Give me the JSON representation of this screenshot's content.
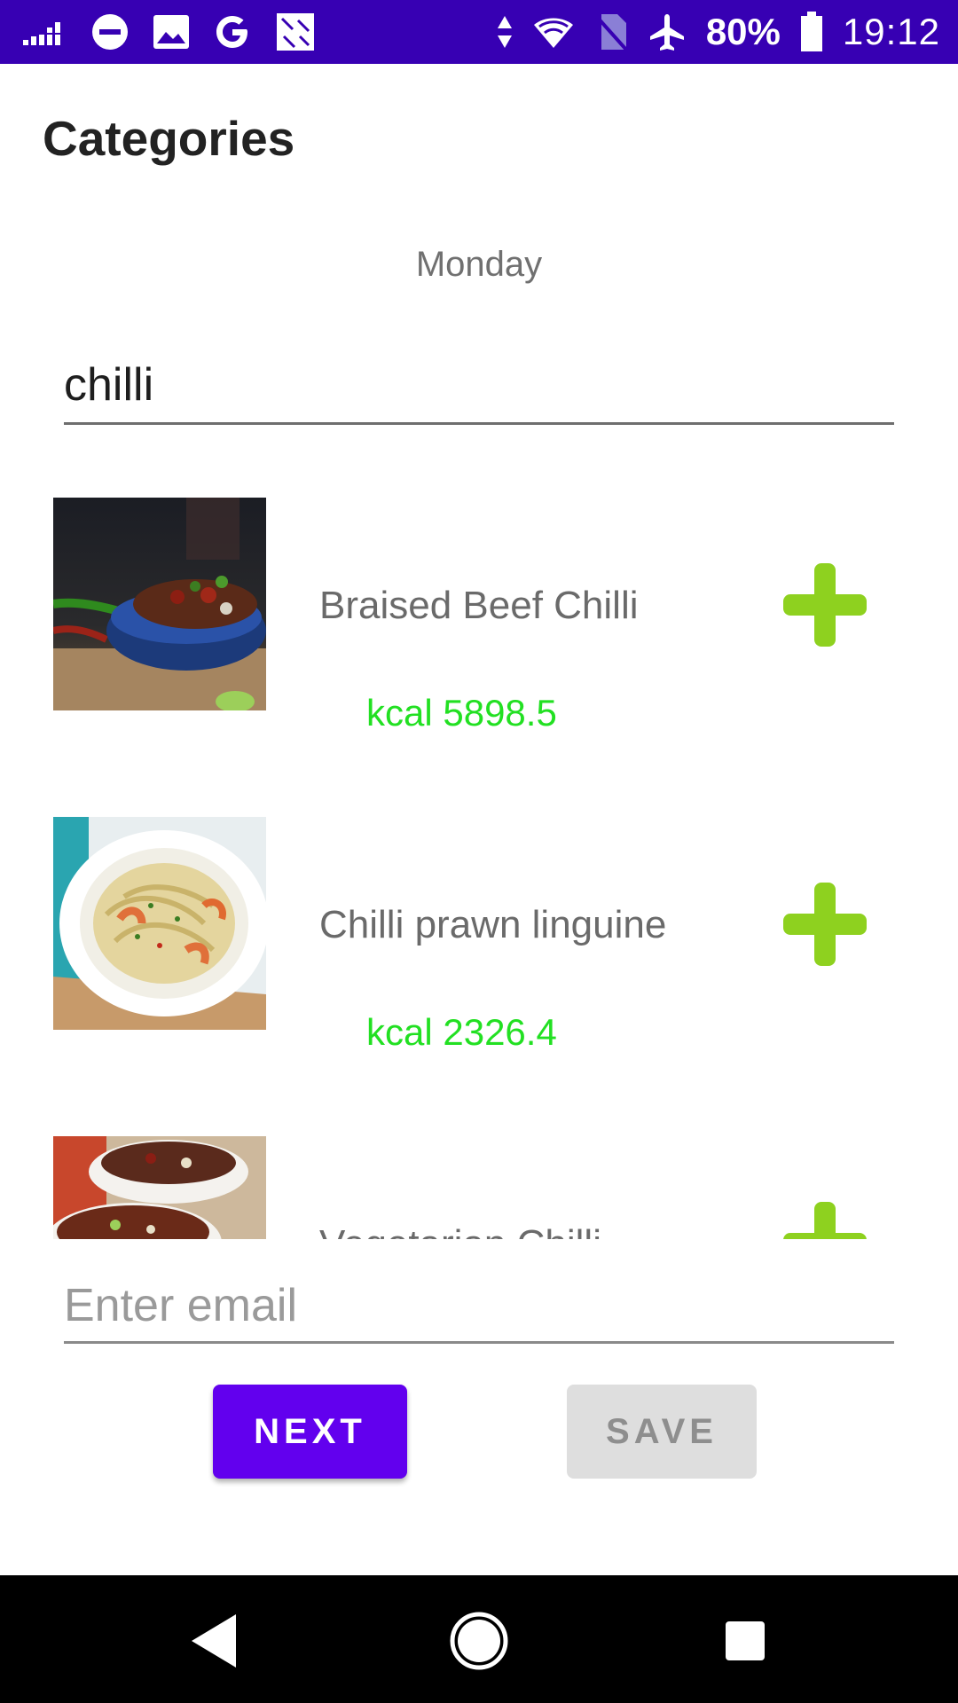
{
  "status_bar": {
    "battery_percent": "80%",
    "time": "19:12",
    "left_icons": [
      "signal-bars-icon",
      "do-not-disturb-icon",
      "gallery-icon",
      "google-icon",
      "app-icon"
    ],
    "right_icons": [
      "data-arrows-icon",
      "wifi-icon",
      "no-sim-icon",
      "airplane-icon",
      "battery-icon"
    ]
  },
  "header": {
    "title": "Categories"
  },
  "day": "Monday",
  "search": {
    "value": "chilli"
  },
  "meals": [
    {
      "name": "Braised Beef Chilli",
      "kcal": "kcal 5898.5",
      "image": "beef-chilli-photo"
    },
    {
      "name": "Chilli prawn linguine",
      "kcal": "kcal 2326.4",
      "image": "prawn-linguine-photo"
    },
    {
      "name": "Vegetarian Chilli",
      "kcal": "",
      "image": "vegetarian-chilli-photo"
    }
  ],
  "email": {
    "value": "",
    "placeholder": "Enter email"
  },
  "buttons": {
    "next": "NEXT",
    "save": "SAVE"
  },
  "colors": {
    "status_bar": "#3700b3",
    "primary": "#6200ee",
    "kcal_green": "#22e022",
    "add_green": "#8ed11f",
    "save_disabled": "#dedede"
  },
  "nav": {
    "icons": [
      "back-icon",
      "home-icon",
      "recents-icon"
    ]
  }
}
